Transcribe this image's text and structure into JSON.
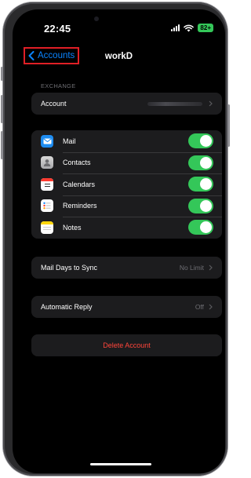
{
  "status_bar": {
    "time": "22:45",
    "battery": "82+",
    "battery_color": "#34c759"
  },
  "nav": {
    "back_label": "Accounts",
    "back_icon": "chevron-left-icon",
    "title": "workD",
    "highlight_color": "#e01f26"
  },
  "exchange": {
    "header": "EXCHANGE",
    "account_label": "Account"
  },
  "sync_items": [
    {
      "label": "Mail",
      "icon": "mail-icon",
      "enabled": true
    },
    {
      "label": "Contacts",
      "icon": "contacts-icon",
      "enabled": true
    },
    {
      "label": "Calendars",
      "icon": "calendar-icon",
      "enabled": true
    },
    {
      "label": "Reminders",
      "icon": "reminders-icon",
      "enabled": true
    },
    {
      "label": "Notes",
      "icon": "notes-icon",
      "enabled": true
    }
  ],
  "mail_days": {
    "label": "Mail Days to Sync",
    "value": "No Limit"
  },
  "auto_reply": {
    "label": "Automatic Reply",
    "value": "Off"
  },
  "delete_account": {
    "label": "Delete Account",
    "color": "#ff453a"
  },
  "colors": {
    "toggle_on": "#34c759",
    "link": "#0a84ff",
    "cell_bg": "#1c1c1e",
    "background": "#000000"
  }
}
